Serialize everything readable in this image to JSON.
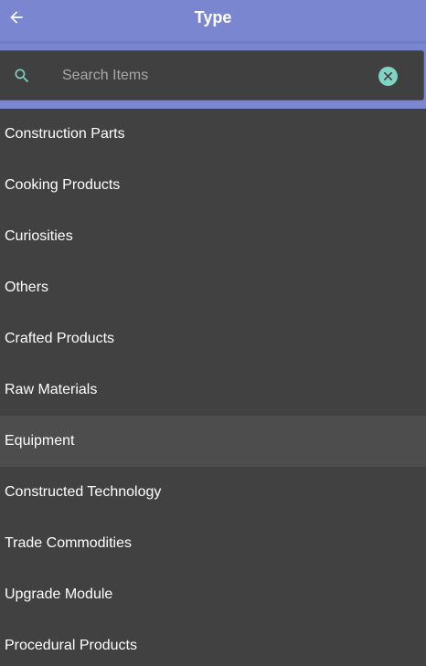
{
  "header": {
    "title": "Type",
    "back_icon": "arrow-left-icon",
    "color": "#7a86d0"
  },
  "search": {
    "placeholder": "Search Items",
    "value": "",
    "search_icon": "search-icon",
    "clear_icon": "clear-icon",
    "accent_color": "#7fd3c2"
  },
  "list": {
    "items": [
      {
        "label": "Construction Parts"
      },
      {
        "label": "Cooking Products"
      },
      {
        "label": "Curiosities"
      },
      {
        "label": "Others"
      },
      {
        "label": "Crafted Products"
      },
      {
        "label": "Raw Materials"
      },
      {
        "label": "Equipment",
        "highlighted": true
      },
      {
        "label": "Constructed Technology"
      },
      {
        "label": "Trade Commodities"
      },
      {
        "label": "Upgrade Module"
      },
      {
        "label": "Procedural Products"
      }
    ]
  }
}
